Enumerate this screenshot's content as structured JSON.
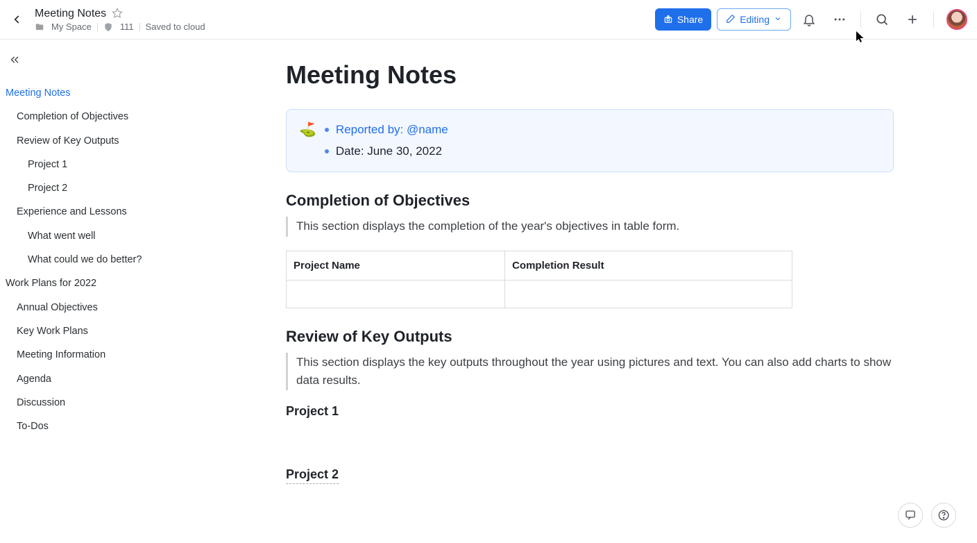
{
  "header": {
    "title": "Meeting Notes",
    "space": "My Space",
    "badge": "111",
    "status": "Saved to cloud",
    "share_label": "Share",
    "editing_label": "Editing"
  },
  "sidebar": {
    "items": [
      {
        "l": "l0",
        "label": "Meeting Notes"
      },
      {
        "l": "l1",
        "label": "Completion of Objectives"
      },
      {
        "l": "l1",
        "label": "Review of Key Outputs"
      },
      {
        "l": "l2",
        "label": "Project 1"
      },
      {
        "l": "l2",
        "label": "Project 2"
      },
      {
        "l": "l1",
        "label": "Experience and Lessons"
      },
      {
        "l": "l2",
        "label": "What went well"
      },
      {
        "l": "l2",
        "label": "What could we do better?"
      },
      {
        "l": "l0b",
        "label": "Work Plans for 2022"
      },
      {
        "l": "l1",
        "label": "Annual Objectives"
      },
      {
        "l": "l1",
        "label": "Key Work Plans"
      },
      {
        "l": "l1",
        "label": "Meeting Information"
      },
      {
        "l": "l1",
        "label": "Agenda"
      },
      {
        "l": "l1",
        "label": "Discussion"
      },
      {
        "l": "l1",
        "label": "To-Dos"
      }
    ]
  },
  "doc": {
    "h1": "Meeting Notes",
    "callout": {
      "emoji": "⛳",
      "reported_prefix": "Reported by: ",
      "reported_name": "@name",
      "date_line": "Date: June 30, 2022"
    },
    "sec1": {
      "heading": "Completion of Objectives",
      "quote": "This section displays the completion of the year's objectives in table form.",
      "table": {
        "cols": [
          "Project Name",
          "Completion Result"
        ]
      }
    },
    "sec2": {
      "heading": "Review of Key Outputs",
      "quote": "This section displays the key outputs throughout the year using pictures and text. You can also add charts to show data results.",
      "sub1": "Project 1",
      "sub2": "Project 2"
    }
  }
}
